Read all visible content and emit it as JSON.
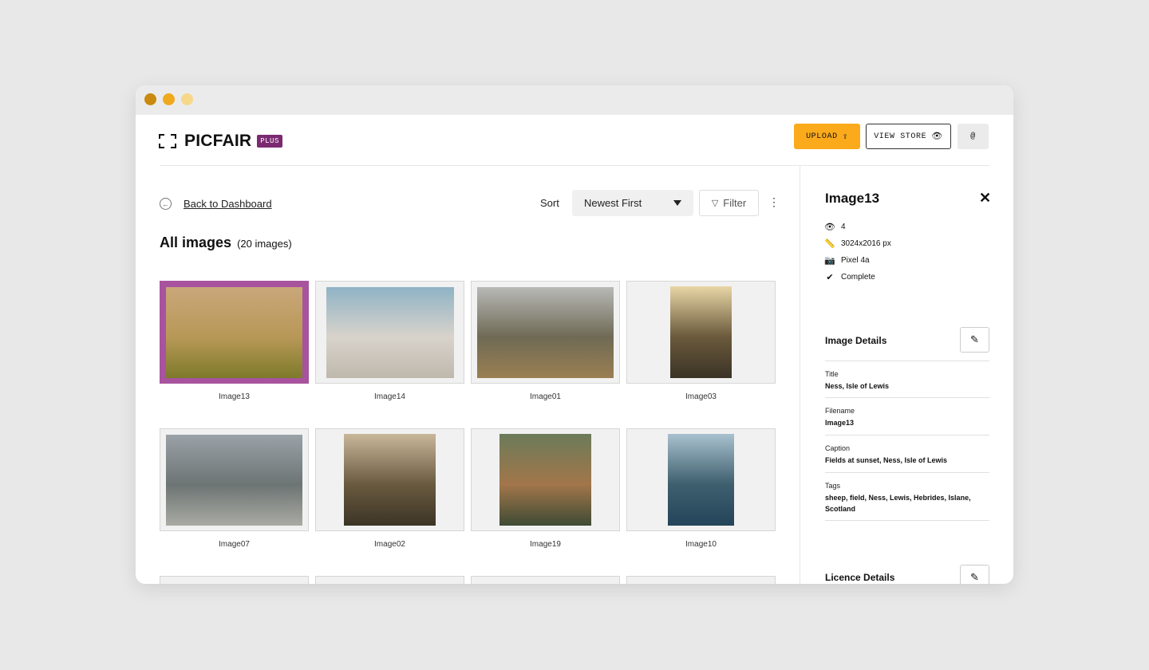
{
  "header": {
    "logo_text": "PICFAIR",
    "logo_badge": "PLUS",
    "upload_label": "UPLOAD",
    "view_store_label": "VIEW STORE",
    "user_icon": "@"
  },
  "toolbar": {
    "back_label": "Back to Dashboard",
    "sort_label": "Sort",
    "sort_value": "Newest First",
    "filter_label": "Filter"
  },
  "gallery": {
    "title": "All images",
    "count": "(20 images)",
    "images": [
      {
        "label": "Image13",
        "colors": [
          "#c9a77a",
          "#b89857",
          "#7d7a2a"
        ],
        "selected": true
      },
      {
        "label": "Image14",
        "colors": [
          "#8fb3c5",
          "#d8d3cb",
          "#bfb8ad"
        ],
        "selected": false
      },
      {
        "label": "Image01",
        "colors": [
          "#b7b9b6",
          "#6f6a55",
          "#9a7f52"
        ],
        "selected": false
      },
      {
        "label": "Image03",
        "colors": [
          "#e8d6a6",
          "#6b5a3c",
          "#3b3326"
        ],
        "selected": false
      },
      {
        "label": "Image07",
        "colors": [
          "#9aa2a8",
          "#6d7474",
          "#a9aba3"
        ],
        "selected": false
      },
      {
        "label": "Image02",
        "colors": [
          "#c9b79a",
          "#6a5a40",
          "#3c3425"
        ],
        "selected": false
      },
      {
        "label": "Image19",
        "colors": [
          "#6b7b5a",
          "#a2764a",
          "#3f4b35"
        ],
        "selected": false
      },
      {
        "label": "Image10",
        "colors": [
          "#a9c1cf",
          "#3e5f6e",
          "#24455a"
        ],
        "selected": false
      }
    ]
  },
  "details": {
    "name": "Image13",
    "views": "4",
    "dimensions": "3024x2016 px",
    "camera": "Pixel 4a",
    "status": "Complete",
    "section_title": "Image Details",
    "fields": [
      {
        "label": "Title",
        "value": "Ness, Isle of Lewis"
      },
      {
        "label": "Filename",
        "value": "Image13"
      },
      {
        "label": "Caption",
        "value": "Fields at sunset, Ness, Isle of Lewis"
      },
      {
        "label": "Tags",
        "value": "sheep, field, Ness, Lewis, Hebrides, Islane, Scotland"
      }
    ],
    "licence_title": "Licence Details"
  }
}
